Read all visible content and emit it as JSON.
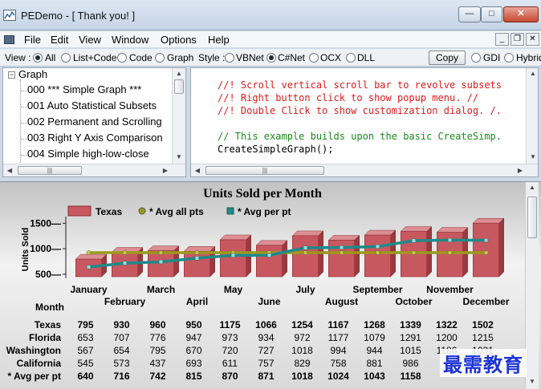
{
  "window": {
    "title": "PEDemo - [ Thank you! ]",
    "min": "—",
    "max": "□",
    "close": "✕"
  },
  "menu": {
    "items": [
      "File",
      "Edit",
      "View",
      "Window",
      "Options",
      "Help"
    ]
  },
  "toolbar": {
    "view_label": "View :",
    "view_options": [
      "All",
      "List+Code",
      "Code",
      "Graph"
    ],
    "view_selected": "All",
    "style_label": "Style :",
    "style_options": [
      "VBNet",
      "C#Net",
      "OCX",
      "DLL"
    ],
    "style_selected": "C#Net",
    "copy_label": "Copy",
    "render_options": [
      "GDI",
      "Hybrid"
    ]
  },
  "tree": {
    "root": "Graph",
    "items": [
      "000  *** Simple Graph ***",
      "001  Auto Statistical Subsets",
      "002  Permanent and Scrolling",
      "003  Right Y Axis Comparison",
      "004  Simple high-low-close"
    ]
  },
  "code": {
    "lines": [
      {
        "text": "//! Scroll vertical scroll bar to revolve subsets",
        "color": "red"
      },
      {
        "text": "//! Right button click to show popup menu. //",
        "color": "red"
      },
      {
        "text": "//! Double Click to show customization dialog. /.",
        "color": "red"
      },
      {
        "text": "",
        "color": "black"
      },
      {
        "text": "// This example builds upon the basic CreateSimp.",
        "color": "green"
      },
      {
        "text": "CreateSimpleGraph();",
        "color": "black"
      }
    ]
  },
  "chart_data": {
    "type": "bar",
    "title": "Units Sold per Month",
    "xlabel": "Month",
    "ylabel": "Units Sold",
    "ylim": [
      450,
      1600
    ],
    "yticks": [
      500,
      1000,
      1500
    ],
    "categories": [
      "January",
      "February",
      "March",
      "April",
      "May",
      "June",
      "July",
      "August",
      "September",
      "October",
      "November",
      "December"
    ],
    "legend": [
      "Texas",
      "* Avg all pts",
      "* Avg per pt"
    ],
    "legend_placement": "top",
    "colors": {
      "bar": "#c8585f",
      "avg_all": "#9a9a1c",
      "avg_per": "#1e8a8a"
    },
    "series": [
      {
        "name": "Texas",
        "values": [
          795,
          930,
          960,
          950,
          1175,
          1066,
          1254,
          1167,
          1268,
          1339,
          1322,
          1502
        ]
      },
      {
        "name": "* Avg all pts",
        "values": [
          922,
          922,
          922,
          922,
          922,
          922,
          922,
          922,
          922,
          922,
          922,
          922
        ]
      },
      {
        "name": "* Avg per pt",
        "values": [
          640,
          716,
          742,
          815,
          870,
          871,
          1018,
          1024,
          1043,
          1158,
          1168,
          1166
        ]
      }
    ],
    "table": {
      "rows": [
        {
          "label": "Texas",
          "values": [
            "795",
            "930",
            "960",
            "950",
            "1175",
            "1066",
            "1254",
            "1167",
            "1268",
            "1339",
            "1322",
            "1502"
          ]
        },
        {
          "label": "Florida",
          "values": [
            "653",
            "707",
            "776",
            "947",
            "973",
            "934",
            "972",
            "1177",
            "1079",
            "1291",
            "1200",
            "1215"
          ]
        },
        {
          "label": "Washington",
          "values": [
            "567",
            "654",
            "795",
            "670",
            "720",
            "727",
            "1018",
            "994",
            "944",
            "1015",
            "1186",
            "1031"
          ]
        },
        {
          "label": "California",
          "values": [
            "545",
            "573",
            "437",
            "693",
            "611",
            "757",
            "829",
            "758",
            "881",
            "986",
            "",
            ""
          ]
        },
        {
          "label": "* Avg per pt",
          "values": [
            "640",
            "716",
            "742",
            "815",
            "870",
            "871",
            "1018",
            "1024",
            "1043",
            "1158",
            "",
            ""
          ]
        }
      ]
    }
  },
  "watermark": "最需教育"
}
